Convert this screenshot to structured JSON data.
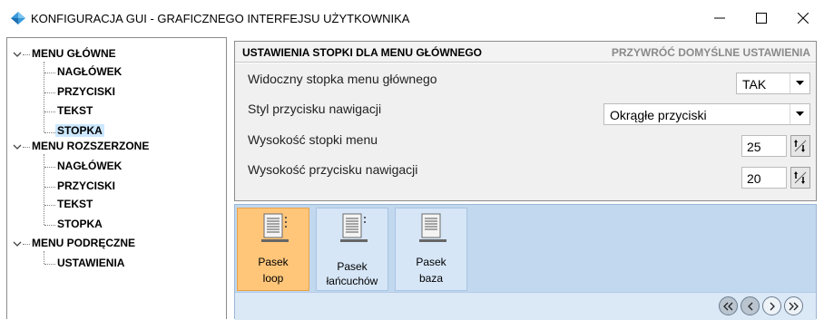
{
  "window": {
    "title": "KONFIGURACJA GUI - GRAFICZNEGO INTERFEJSU UŻYTKOWNIKA",
    "icon": "app-diamond-icon",
    "controls": [
      "minimize-icon",
      "maximize-icon",
      "close-icon"
    ]
  },
  "tree": {
    "groups": [
      {
        "label": "MENU GŁÓWNE",
        "children": [
          "NAGŁÓWEK",
          "PRZYCISKI",
          "TEKST",
          "STOPKA"
        ]
      },
      {
        "label": "MENU ROZSZERZONE",
        "children": [
          "NAGŁÓWEK",
          "PRZYCISKI",
          "TEKST",
          "STOPKA"
        ]
      },
      {
        "label": "MENU PODRĘCZNE",
        "children": [
          "USTAWIENIA"
        ]
      }
    ],
    "selected": "STOPKA"
  },
  "settings": {
    "title": "USTAWIENIA STOPKI DLA MENU GŁÓWNEGO",
    "reset_label": "PRZYWRÓĆ DOMYŚLNE USTAWIENIA",
    "rows": [
      {
        "label": "Widoczny stopka menu głównego",
        "value": "TAK"
      },
      {
        "label": "Styl przycisku nawigacji",
        "value": "Okrągłe przyciski"
      },
      {
        "label": "Wysokość stopki menu",
        "value": "25"
      },
      {
        "label": "Wysokość przycisku nawigacji",
        "value": "20"
      }
    ]
  },
  "toolbar": {
    "tiles": [
      {
        "line1": "Pasek",
        "line2": "loop",
        "active": true
      },
      {
        "line1": "Pasek",
        "line2": "łańcuchów",
        "active": false
      },
      {
        "line1": "Pasek",
        "line2": "baza",
        "active": false
      }
    ],
    "nav_buttons": [
      "first-page-icon",
      "previous-page-icon",
      "next-page-icon",
      "last-page-icon"
    ]
  },
  "colors": {
    "selection": "#cce8ff",
    "active_tile": "#ffc67a",
    "strip_bg": "#c1d8ee",
    "app_icon": "#3a9ad9"
  }
}
